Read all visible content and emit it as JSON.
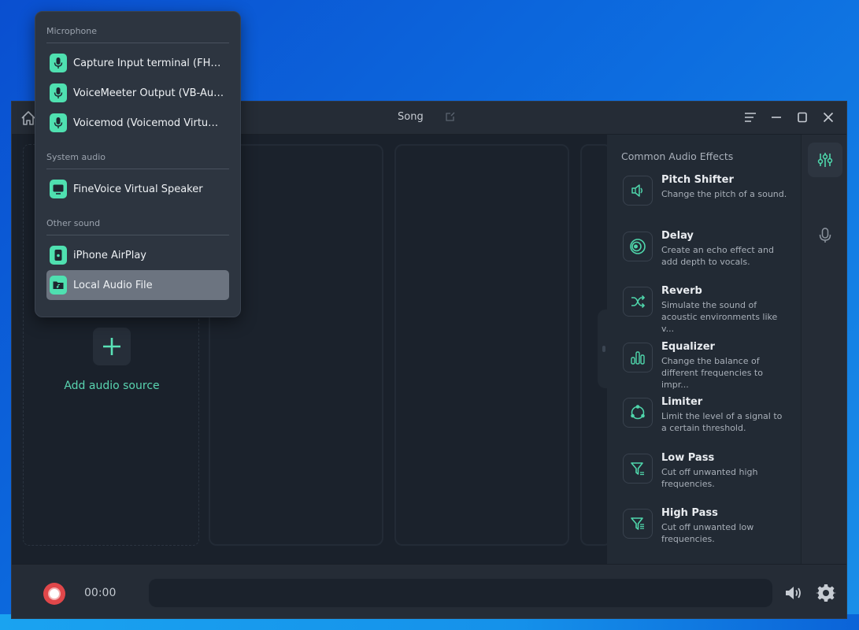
{
  "window": {
    "title": "Song"
  },
  "stage": {
    "add_source_label": "Add audio source"
  },
  "effects": {
    "title": "Common Audio Effects",
    "items": [
      {
        "name": "Pitch Shifter",
        "description": "Change the pitch of a sound.",
        "icon": "speaker-icon"
      },
      {
        "name": "Delay",
        "description": "Create an echo effect and add depth to vocals.",
        "icon": "echo-rings-icon"
      },
      {
        "name": "Reverb",
        "description": "Simulate the sound of acoustic environments like v...",
        "icon": "shuffle-icon"
      },
      {
        "name": "Equalizer",
        "description": "Change the balance of different frequencies to impr...",
        "icon": "bars-icon"
      },
      {
        "name": "Limiter",
        "description": "Limit the level of a signal to a certain threshold.",
        "icon": "cycle-icon"
      },
      {
        "name": "Low Pass",
        "description": "Cut off unwanted high frequencies.",
        "icon": "filter-icon"
      },
      {
        "name": "High Pass",
        "description": "Cut off unwanted low frequencies.",
        "icon": "filter-lines-icon"
      }
    ]
  },
  "side_rail": {
    "items": [
      {
        "name": "effects",
        "icon": "sliders-icon",
        "active": true
      },
      {
        "name": "microphone",
        "icon": "microphone-icon",
        "active": false
      }
    ]
  },
  "bottom_bar": {
    "timer": "00:00"
  },
  "dropdown": {
    "sections": [
      {
        "label": "Microphone",
        "items": [
          {
            "label": "Capture Input terminal (FHD...",
            "icon": "microphone-icon",
            "selected": false
          },
          {
            "label": "VoiceMeeter Output (VB-Audi...",
            "icon": "microphone-icon",
            "selected": false
          },
          {
            "label": "Voicemod (Voicemod Virtual...",
            "icon": "microphone-icon",
            "selected": false
          }
        ]
      },
      {
        "label": "System audio",
        "items": [
          {
            "label": "FineVoice Virtual Speaker",
            "icon": "monitor-icon",
            "selected": false
          }
        ]
      },
      {
        "label": "Other sound",
        "items": [
          {
            "label": "iPhone AirPlay",
            "icon": "phone-icon",
            "selected": false
          },
          {
            "label": "Local Audio File",
            "icon": "folder-music-icon",
            "selected": true
          }
        ]
      }
    ]
  },
  "colors": {
    "accent": "#4fe0b0",
    "record": "#e0474a",
    "window_bg": "#1b222c",
    "panel_bg": "#222a34"
  }
}
